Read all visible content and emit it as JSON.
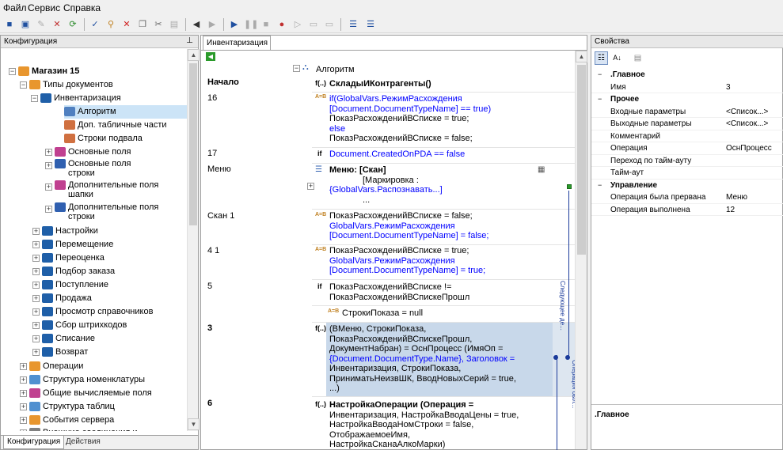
{
  "menu": [
    "Файл",
    "Сервис",
    "Справка"
  ],
  "left": {
    "title": "Конфигурация",
    "tabs": [
      "Конфигурация",
      "Действия"
    ],
    "tree": [
      {
        "label": "Магазин 15",
        "bold": true,
        "color": "#e8962e"
      },
      {
        "label": "Типы документов",
        "color": "#e8962e"
      },
      {
        "label": "Инвентаризация",
        "color": "#1f5fa8"
      },
      {
        "label": "Алгоритм",
        "color": "#5080c0",
        "selected": true
      },
      {
        "label": "Доп. табличные части",
        "color": "#d07040"
      },
      {
        "label": "Строки подвала",
        "color": "#d07040"
      },
      {
        "label": "Основные поля",
        "color": "#c04090"
      },
      {
        "label": "Основные поля",
        "label2": "строки",
        "color": "#3060b0"
      },
      {
        "label": "Дополнительные поля",
        "label2": "шапки",
        "color": "#c04090"
      },
      {
        "label": "Дополнительные поля",
        "label2": "строки",
        "color": "#3060b0"
      },
      {
        "label": "Настройки",
        "color": "#1f5fa8"
      },
      {
        "label": "Перемещение",
        "color": "#1f5fa8"
      },
      {
        "label": "Переоценка",
        "color": "#1f5fa8"
      },
      {
        "label": "Подбор заказа",
        "color": "#1f5fa8"
      },
      {
        "label": "Поступление",
        "color": "#1f5fa8"
      },
      {
        "label": "Продажа",
        "color": "#1f5fa8"
      },
      {
        "label": "Просмотр справочников",
        "color": "#1f5fa8"
      },
      {
        "label": "Сбор штрихкодов",
        "color": "#1f5fa8"
      },
      {
        "label": "Списание",
        "color": "#1f5fa8"
      },
      {
        "label": "Возврат",
        "color": "#1f5fa8"
      },
      {
        "label": "Операции",
        "color": "#e8962e"
      },
      {
        "label": "Структура номенклатуры",
        "color": "#5090d0"
      },
      {
        "label": "Общие вычисляемые поля",
        "color": "#c04090"
      },
      {
        "label": "Структура таблиц",
        "color": "#5090d0"
      },
      {
        "label": "События сервера",
        "color": "#e8962e"
      },
      {
        "label": "Внешние соединения и",
        "color": "#808080"
      }
    ]
  },
  "mid": {
    "tab": "Инвентаризация",
    "root": "Алгоритм",
    "labels": [
      "Начало",
      "16",
      "17",
      "Меню",
      "Скан 1",
      "4 1",
      "5",
      "3",
      "6"
    ],
    "c0": "СкладыИКонтрагенты()",
    "c1": [
      "if(GlobalVars.РежимРасхождения",
      "[Document.DocumentTypeName] == true)",
      "ПоказРасхожденийВСписке = true;",
      "else",
      "ПоказРасхожденийВСписке = false;"
    ],
    "c2": "Document.CreatedOnPDA == false",
    "c3": [
      "Меню: [Скан]",
      "[Маркировка :",
      "{GlobalVars.Распознавать...]",
      "..."
    ],
    "c4": [
      "ПоказРасхожденийВСписке = false;",
      "GlobalVars.РежимРасхождения",
      "[Document.DocumentTypeName] = false;"
    ],
    "c5": [
      "ПоказРасхожденийВСписке = true;",
      "GlobalVars.РежимРасхождения",
      "[Document.DocumentTypeName] = true;"
    ],
    "c6": [
      "ПоказРасхожденийВСписке !=",
      "ПоказРасхожденийВСпискеПрошл"
    ],
    "c6b": "СтрокиПоказа = null",
    "c7": [
      "(ВМеню, СтрокиПоказа,",
      "ПоказРасхожденийВСпискеПрошл,",
      "ДокументНабран) = ОснПроцесс (ИмяОп =",
      "{Document.DocumentType.Name}, Заголовок =",
      "Инвентаризация, СтрокиПоказа,",
      "ПриниматьНеизвШК, ВводНовыхСерий = true,",
      "...)"
    ],
    "c8": [
      "НастройкаОперации (Операция =",
      "Инвентаризация, НастройкаВводаЦены = true,",
      "НастройкаВводаНомСтроки = false,",
      "ОтображаемоеИмя,",
      "НастройкаСканаАлкоМарки)"
    ],
    "side1": "Следующее де...",
    "side2": "Операция был..."
  },
  "right": {
    "title": "Свойства",
    "bottom": ".Главное",
    "props": [
      {
        "cat": ".Главное"
      },
      {
        "k": "Имя",
        "v": "3"
      },
      {
        "cat": "Прочее"
      },
      {
        "k": "Входные параметры",
        "v": "<Список...>"
      },
      {
        "k": "Выходные параметры",
        "v": "<Список...>"
      },
      {
        "k": "Комментарий",
        "v": ""
      },
      {
        "k": "Операция",
        "v": "ОснПроцесс"
      },
      {
        "k": "Переход по тайм-ауту",
        "v": ""
      },
      {
        "k": "Тайм-аут",
        "v": ""
      },
      {
        "cat": "Управление"
      },
      {
        "k": "Операция была прервана",
        "v": "Меню"
      },
      {
        "k": "Операция выполнена",
        "v": "12"
      }
    ]
  }
}
